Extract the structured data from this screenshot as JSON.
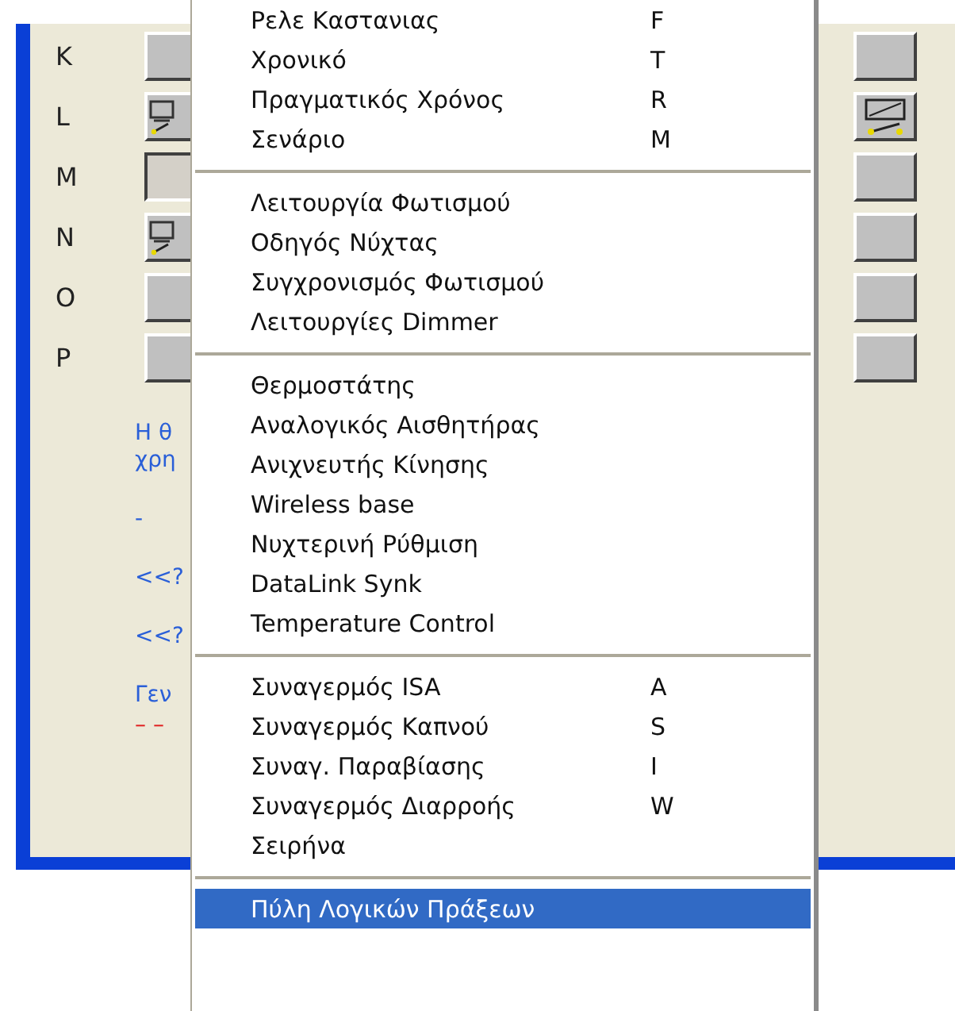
{
  "rows": [
    {
      "label": "K",
      "left_icon": false,
      "right_icon": false,
      "pressed": false
    },
    {
      "label": "L",
      "left_icon": true,
      "right_icon": true,
      "pressed": false
    },
    {
      "label": "M",
      "left_icon": false,
      "right_icon": false,
      "pressed": true
    },
    {
      "label": "N",
      "left_icon": true,
      "right_icon": false,
      "pressed": false
    },
    {
      "label": "O",
      "left_icon": false,
      "right_icon": false,
      "pressed": false
    },
    {
      "label": "P",
      "left_icon": false,
      "right_icon": false,
      "pressed": false
    }
  ],
  "notes": [
    {
      "text": "Η θ",
      "kind": "info"
    },
    {
      "text": "χρη",
      "kind": "info"
    },
    {
      "text": "-",
      "kind": "info"
    },
    {
      "text": "<<?",
      "kind": "info"
    },
    {
      "text": "<<?",
      "kind": "info"
    },
    {
      "text": "Γεν",
      "kind": "info"
    },
    {
      "text": "– –",
      "kind": "error"
    }
  ],
  "menu": {
    "groups": [
      [
        {
          "label": "Ρελε Καστανιας",
          "shortcut": "F",
          "selected": false
        },
        {
          "label": "Χρονικό",
          "shortcut": "T",
          "selected": false
        },
        {
          "label": "Πραγματικός Χρόνος",
          "shortcut": "R",
          "selected": false
        },
        {
          "label": "Σενάριο",
          "shortcut": "M",
          "selected": false
        }
      ],
      [
        {
          "label": "Λειτουργία Φωτισμού",
          "selected": false
        },
        {
          "label": "Οδηγός Νύχτας",
          "selected": false
        },
        {
          "label": "Συγχρονισμός Φωτισμού",
          "selected": false
        },
        {
          "label": "Λειτουργίες Dimmer",
          "selected": false
        }
      ],
      [
        {
          "label": "Θερμοστάτης",
          "selected": false
        },
        {
          "label": "Αναλογικός Αισθητήρας",
          "selected": false
        },
        {
          "label": "Ανιχνευτής Κίνησης",
          "selected": false
        },
        {
          "label": "Wireless base",
          "selected": false
        },
        {
          "label": "Νυχτερινή Ρύθμιση",
          "selected": false
        },
        {
          "label": "DataLink Synk",
          "selected": false
        },
        {
          "label": "Temperature Control",
          "selected": false
        }
      ],
      [
        {
          "label": "Συναγερμός ISA",
          "shortcut": "A",
          "selected": false
        },
        {
          "label": "Συναγερμός Καπνού",
          "shortcut": "S",
          "selected": false
        },
        {
          "label": "Συναγ. Παραβίασης",
          "shortcut": "I",
          "selected": false
        },
        {
          "label": "Συναγερμός Διαρροής",
          "shortcut": "W",
          "selected": false
        },
        {
          "label": "Σειρήνα",
          "selected": false
        }
      ],
      [
        {
          "label": "Πύλη Λογικών Πράξεων",
          "selected": true
        }
      ]
    ]
  }
}
